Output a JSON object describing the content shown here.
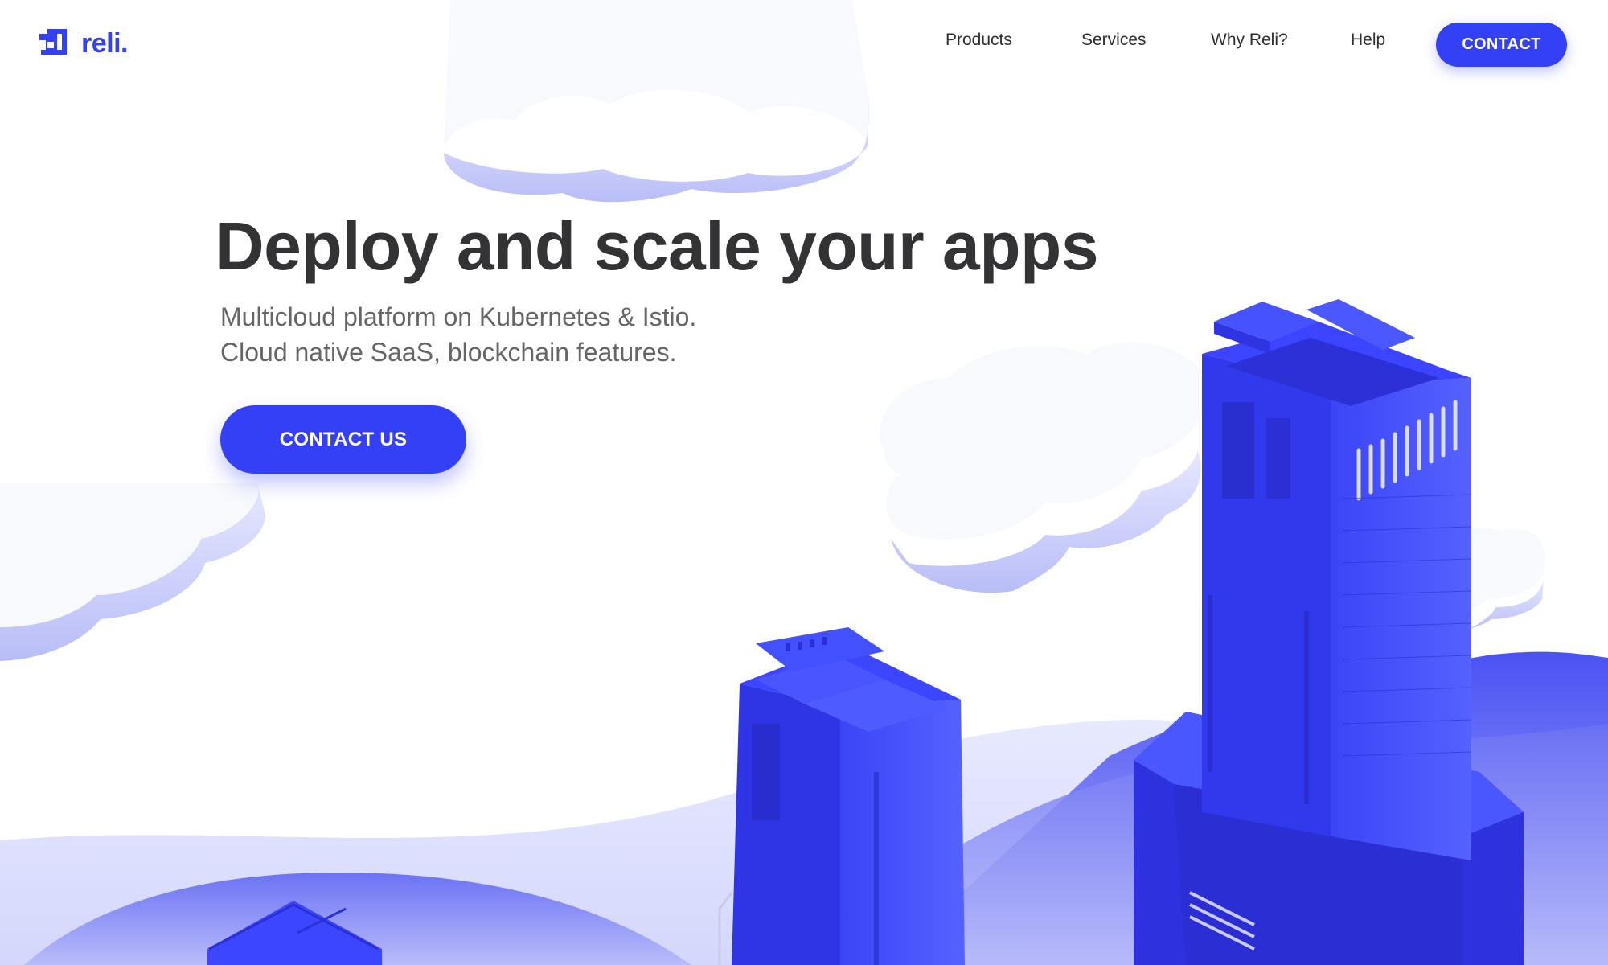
{
  "brand": {
    "name": "reli.",
    "logo_icon": "reli-logo-icon",
    "accent_color": "#3340f5"
  },
  "nav": {
    "links": [
      {
        "label": "Products"
      },
      {
        "label": "Services"
      },
      {
        "label": "Why Reli?"
      },
      {
        "label": "Help"
      }
    ],
    "contact_label": "CONTACT"
  },
  "hero": {
    "title": "Deploy and scale your apps",
    "subtitle_lines": [
      "Multicloud platform on Kubernetes & Istio.",
      "Cloud native SaaS, blockchain features."
    ],
    "cta_label": "CONTACT US"
  },
  "illustration": {
    "icon": "isometric-city-clouds-illustration",
    "colors": {
      "building": "#3a3ef0",
      "hill": "#5c63f2",
      "cloud": "#f6f8fb"
    }
  }
}
